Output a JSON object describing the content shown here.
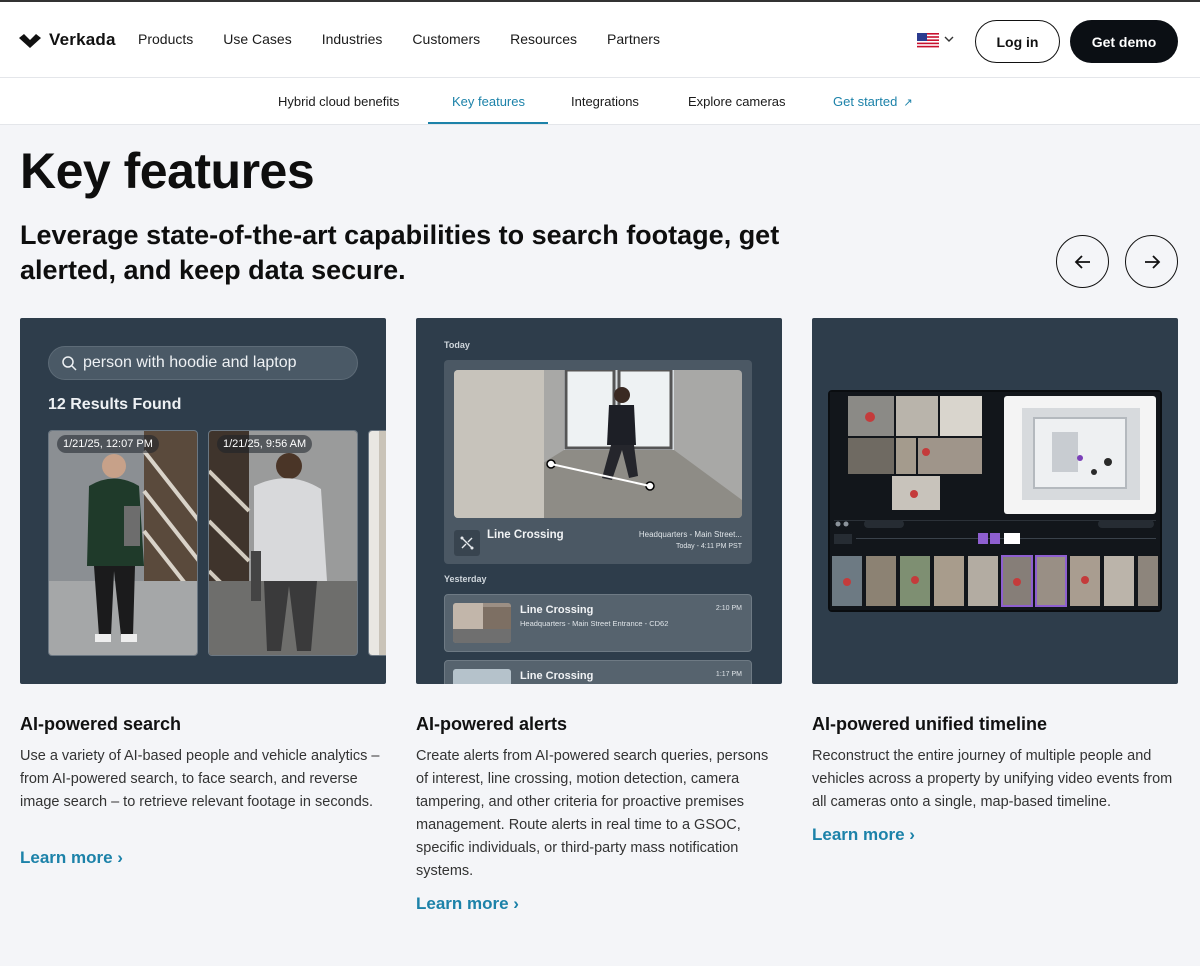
{
  "brand": {
    "name": "Verkada"
  },
  "nav": {
    "items": [
      "Products",
      "Use Cases",
      "Industries",
      "Customers",
      "Resources",
      "Partners"
    ],
    "login_label": "Log in",
    "demo_label": "Get demo"
  },
  "subnav": {
    "items": [
      "Hybrid cloud benefits",
      "Key features",
      "Integrations",
      "Explore cameras"
    ],
    "cta": "Get started",
    "active_index": 1
  },
  "hero": {
    "title": "Key features",
    "subtitle": "Leverage state-of-the-art capabilities to search footage, get alerted, and keep data secure."
  },
  "cards": [
    {
      "title": "AI-powered search",
      "description": "Use a variety of AI-based people and vehicle analytics – from AI-powered search, to face search, and reverse image search – to retrieve relevant footage in seconds.",
      "learn_more": "Learn more ›",
      "search_query": "person with hoodie and laptop",
      "results_label": "12 Results Found",
      "thumbs": [
        "1/21/25, 12:07 PM",
        "1/21/25, 9:56 AM"
      ]
    },
    {
      "title": "AI-powered alerts",
      "description": "Create alerts from AI-powered search queries, persons of interest, line crossing, motion detection, camera tampering, and other criteria for proactive premises management. Route alerts in real time to a GSOC, specific individuals, or third-party mass notification systems.",
      "learn_more": "Learn more ›",
      "today_label": "Today",
      "yesterday_label": "Yesterday",
      "main_alert": {
        "title": "Line Crossing",
        "location": "Headquarters - Main Street...",
        "time": "Today - 4:11 PM PST"
      },
      "rows": [
        {
          "title": "Line Crossing",
          "sub": "Headquarters - Main Street Entrance - CD62",
          "time": "2:10 PM"
        },
        {
          "title": "Line Crossing",
          "sub": "",
          "time": "1:17 PM"
        }
      ]
    },
    {
      "title": "AI-powered unified timeline",
      "description": "Reconstruct the entire journey of multiple people and vehicles across a property by unifying video events from all cameras onto a single, map-based timeline.",
      "learn_more": "Learn more ›"
    }
  ],
  "colors": {
    "accent": "#1c82a9",
    "card_bg": "#2e3d4b",
    "dark_button": "#0b0f14"
  }
}
